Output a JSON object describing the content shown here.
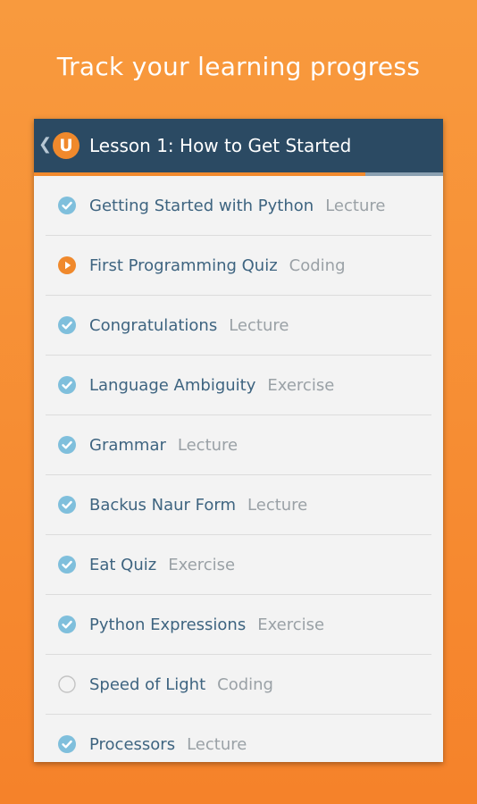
{
  "headline": "Track your learning progress",
  "colors": {
    "background": "#f5822a",
    "header": "#2b4a63",
    "accent": "#f0892c",
    "check": "#7fbfdc",
    "title_text": "#3e6480",
    "type_text": "#9aa1a6"
  },
  "header": {
    "back_icon": "chevron-left-icon",
    "logo_letter": "U",
    "title": "Lesson 1: How to Get Started",
    "progress": 0.81
  },
  "items": [
    {
      "title": "Getting Started with Python",
      "type": "Lecture",
      "status": "complete"
    },
    {
      "title": "First Programming Quiz",
      "type": "Coding",
      "status": "in-progress"
    },
    {
      "title": "Congratulations",
      "type": "Lecture",
      "status": "complete"
    },
    {
      "title": "Language Ambiguity",
      "type": "Exercise",
      "status": "complete"
    },
    {
      "title": "Grammar",
      "type": "Lecture",
      "status": "complete"
    },
    {
      "title": "Backus Naur Form",
      "type": "Lecture",
      "status": "complete"
    },
    {
      "title": "Eat Quiz",
      "type": "Exercise",
      "status": "complete"
    },
    {
      "title": "Python Expressions",
      "type": "Exercise",
      "status": "complete"
    },
    {
      "title": "Speed of Light",
      "type": "Coding",
      "status": "not-started"
    },
    {
      "title": "Processors",
      "type": "Lecture",
      "status": "complete"
    }
  ]
}
